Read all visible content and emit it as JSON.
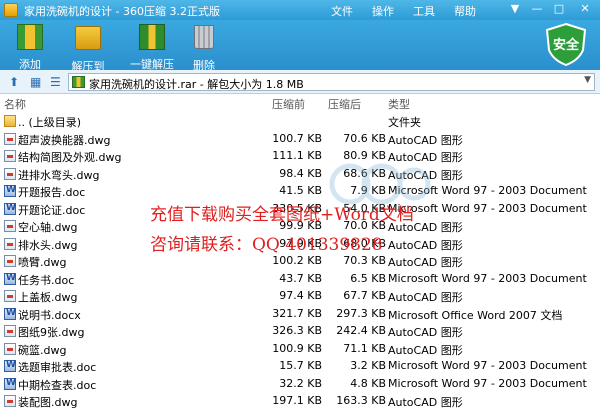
{
  "window": {
    "title": "家用洗碗机的设计 - 360压缩 3.2正式版",
    "menu": [
      "文件",
      "操作",
      "工具",
      "帮助"
    ],
    "controls": [
      "▼",
      "—",
      "□",
      "✕"
    ]
  },
  "toolbar": {
    "items": [
      {
        "label": "添加",
        "icon": "add-archive-icon"
      },
      {
        "label": "解压到",
        "icon": "extract-to-icon"
      },
      {
        "label": "一键解压",
        "icon": "one-click-extract-icon"
      },
      {
        "label": "删除",
        "icon": "delete-trash-icon"
      }
    ],
    "badge": "安全",
    "badge_color": "#2e9e3b"
  },
  "address": {
    "path": "家用洗碗机的设计.rar - 解包大小为 1.8 MB"
  },
  "columns": {
    "name": "名称",
    "original": "压缩前",
    "compressed": "压缩后",
    "type": "类型"
  },
  "files": [
    {
      "name": ".. (上级目录)",
      "orig": "",
      "comp": "",
      "type": "文件夹",
      "icon": "folder-icon"
    },
    {
      "name": "超声波换能器.dwg",
      "orig": "100.7 KB",
      "comp": "70.6 KB",
      "type": "AutoCAD 图形",
      "icon": "dwg-file-icon"
    },
    {
      "name": "结构简图及外观.dwg",
      "orig": "111.1 KB",
      "comp": "80.9 KB",
      "type": "AutoCAD 图形",
      "icon": "dwg-file-icon"
    },
    {
      "name": "进排水弯头.dwg",
      "orig": "98.4 KB",
      "comp": "68.6 KB",
      "type": "AutoCAD 图形",
      "icon": "dwg-file-icon"
    },
    {
      "name": "开题报告.doc",
      "orig": "41.5 KB",
      "comp": "7.9 KB",
      "type": "Microsoft Word 97 - 2003 Document",
      "icon": "doc-file-icon"
    },
    {
      "name": "开题论证.doc",
      "orig": "330.5 KB",
      "comp": "54.0 KB",
      "type": "Microsoft Word 97 - 2003 Document",
      "icon": "doc-file-icon"
    },
    {
      "name": "空心轴.dwg",
      "orig": "99.9 KB",
      "comp": "70.0 KB",
      "type": "AutoCAD 图形",
      "icon": "dwg-file-icon"
    },
    {
      "name": "排水头.dwg",
      "orig": "97.9 KB",
      "comp": "68.0 KB",
      "type": "AutoCAD 图形",
      "icon": "dwg-file-icon"
    },
    {
      "name": "喷臂.dwg",
      "orig": "100.2 KB",
      "comp": "70.3 KB",
      "type": "AutoCAD 图形",
      "icon": "dwg-file-icon"
    },
    {
      "name": "任务书.doc",
      "orig": "43.7 KB",
      "comp": "6.5 KB",
      "type": "Microsoft Word 97 - 2003 Document",
      "icon": "doc-file-icon"
    },
    {
      "name": "上盖板.dwg",
      "orig": "97.4 KB",
      "comp": "67.7 KB",
      "type": "AutoCAD 图形",
      "icon": "dwg-file-icon"
    },
    {
      "name": "说明书.docx",
      "orig": "321.7 KB",
      "comp": "297.3 KB",
      "type": "Microsoft Office Word 2007 文档",
      "icon": "doc-file-icon"
    },
    {
      "name": "图纸9张.dwg",
      "orig": "326.3 KB",
      "comp": "242.4 KB",
      "type": "AutoCAD 图形",
      "icon": "dwg-file-icon"
    },
    {
      "name": "碗篮.dwg",
      "orig": "100.9 KB",
      "comp": "71.1 KB",
      "type": "AutoCAD 图形",
      "icon": "dwg-file-icon"
    },
    {
      "name": "选题审批表.doc",
      "orig": "15.7 KB",
      "comp": "3.2 KB",
      "type": "Microsoft Word 97 - 2003 Document",
      "icon": "doc-file-icon"
    },
    {
      "name": "中期检查表.doc",
      "orig": "32.2 KB",
      "comp": "4.8 KB",
      "type": "Microsoft Word 97 - 2003 Document",
      "icon": "doc-file-icon"
    },
    {
      "name": "装配图.dwg",
      "orig": "197.1 KB",
      "comp": "163.3 KB",
      "type": "AutoCAD 图形",
      "icon": "dwg-file-icon"
    }
  ],
  "watermark": {
    "line1": "充值下载购买全套图纸+Word文档",
    "line2": "咨询请联系：QQ 401339828",
    "color": "#e02020"
  }
}
